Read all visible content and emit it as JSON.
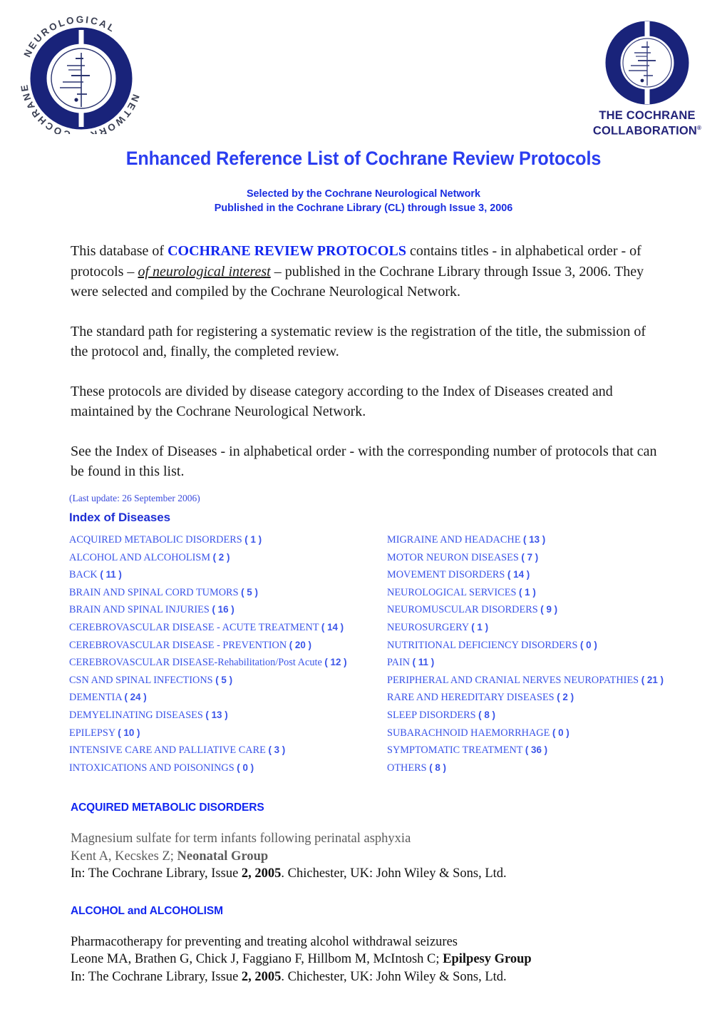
{
  "logos": {
    "left": {
      "name": "cochrane-neurological-network-logo",
      "ring_text": "COCHRANE NEUROLOGICAL NETWORK",
      "color": "#19237a"
    },
    "right": {
      "name": "the-cochrane-collaboration-logo",
      "wordmark_line1": "THE COCHRANE",
      "wordmark_line2": "COLLABORATION",
      "registered_mark": "®",
      "color": "#23237a"
    }
  },
  "header": {
    "title": "Enhanced Reference List of Cochrane Review Protocols",
    "subtitle_1": "Selected by the Cochrane Neurological Network",
    "subtitle_2": "Published in the Cochrane Library (CL) through Issue 3, 2006",
    "title_color": "#2b3ef0",
    "subtitle_color": "#1a2ee0"
  },
  "intro": {
    "p1_part1": "This database of ",
    "p1_highlight": "COCHRANE REVIEW PROTOCOLS",
    "p1_part2": " contains titles - in alphabetical order - of protocols – ",
    "p1_italic": "of neurological interest",
    "p1_part3": " – published in the Cochrane Library through Issue 3, 2006. They were selected and compiled by the Cochrane Neurological Network.",
    "p2": "The standard path for registering a systematic review is the registration of the title, the submission of the protocol and, finally, the completed review.",
    "p3": "These protocols are divided by disease category according to the Index of Diseases created and maintained by the Cochrane Neurological Network.",
    "p4": "See the Index of Diseases - in alphabetical order - with the corresponding number of protocols that can be found in this list."
  },
  "index": {
    "last_update": "(Last update: 26 September 2006)",
    "heading": "Index of Diseases",
    "left_column": [
      {
        "label": "ACQUIRED METABOLIC DISORDERS",
        "count": "( 1  )"
      },
      {
        "label": "ALCOHOL  AND ALCOHOLISM",
        "count": "( 2  )"
      },
      {
        "label": "BACK",
        "count": "( 11 )"
      },
      {
        "label": "BRAIN AND SPINAL CORD TUMORS",
        "count": "( 5  )"
      },
      {
        "label": "BRAIN AND SPINAL INJURIES",
        "count": "( 16  )"
      },
      {
        "label": "CEREBROVASCULAR DISEASE -  ACUTE TREATMENT",
        "count": "( 14 )"
      },
      {
        "label": "CEREBROVASCULAR DISEASE -  PREVENTION",
        "count": "( 20 )"
      },
      {
        "label": "CEREBROVASCULAR DISEASE-Rehabilitation/Post Acute",
        "count": "( 12 )"
      },
      {
        "label": "CSN AND SPINAL INFECTIONS",
        "count": "( 5 )"
      },
      {
        "label": "DEMENTIA",
        "count": "( 24 )"
      },
      {
        "label": "DEMYELINATING DISEASES",
        "count": "( 13 )"
      },
      {
        "label": "EPILEPSY",
        "count": "( 10 )"
      },
      {
        "label": "INTENSIVE CARE AND PALLIATIVE CARE",
        "count": "( 3 )"
      },
      {
        "label": "INTOXICATIONS AND POISONINGS",
        "count": "( 0 )"
      }
    ],
    "right_column": [
      {
        "label": "MIGRAINE AND HEADACHE",
        "count": "( 13 )"
      },
      {
        "label": "MOTOR NEURON DISEASES",
        "count": "( 7  )"
      },
      {
        "label": "MOVEMENT DISORDERS",
        "count": "( 14 )"
      },
      {
        "label": "NEUROLOGICAL SERVICES ",
        "count": "( 1 )"
      },
      {
        "label": "NEUROMUSCULAR DISORDERS",
        "count": "( 9 )"
      },
      {
        "label": "NEUROSURGERY",
        "count": "( 1 )"
      },
      {
        "label": "NUTRITIONAL DEFICIENCY DISORDERS",
        "count": "( 0 )"
      },
      {
        "label": "PAIN",
        "count": "( 11 )"
      },
      {
        "label": "PERIPHERAL AND CRANIAL NERVES NEUROPATHIES ",
        "count": "( 21 )"
      },
      {
        "label": "RARE AND HEREDITARY DISEASES",
        "count": "( 2 )"
      },
      {
        "label": "SLEEP DISORDERS",
        "count": "( 8 )"
      },
      {
        "label": "SUBARACHNOID HAEMORRHAGE",
        "count": "( 0 )"
      },
      {
        "label": "SYMPTOMATIC TREATMENT",
        "count": "( 36 )"
      },
      {
        "label": "OTHERS ",
        "count": "( 8 )"
      }
    ]
  },
  "entries": [
    {
      "category": "ACQUIRED METABOLIC DISORDERS",
      "title": "Magnesium sulfate for term infants following perinatal asphyxia",
      "authors": "Kent A, Kecskes Z; ",
      "group": "Neonatal Group",
      "citation_pre": "In: The Cochrane Library, Issue ",
      "citation_issue": "2, 2005",
      "citation_post": ". Chichester, UK: John Wiley & Sons, Ltd."
    },
    {
      "category": "ALCOHOL and ALCOHOLISM",
      "title": "Pharmacotherapy for preventing and treating alcohol withdrawal seizures",
      "authors": "Leone MA, Brathen G, Chick J, Faggiano F, Hillbom M, McIntosh C; ",
      "group": "Epilpesy Group",
      "citation_pre": "In: The Cochrane Library, Issue ",
      "citation_issue": "2, 2005",
      "citation_post": ". Chichester, UK: John Wiley & Sons, Ltd."
    }
  ]
}
